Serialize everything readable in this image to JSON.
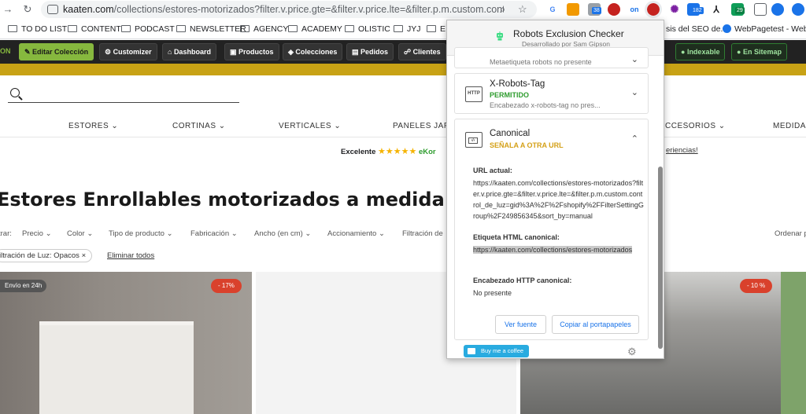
{
  "browser": {
    "url_host": "kaaten.com",
    "url_path": "/collections/estores-motorizados?filter.v.price.gte=&filter.v.price.lte=&filter.p.m.custom.control_de_luz=gid...",
    "ext_badges": [
      "38",
      "182",
      "29"
    ],
    "ext_letters": [
      "G",
      "on"
    ]
  },
  "bookmarks": [
    {
      "label": "TO DO LIST"
    },
    {
      "label": "CONTENT"
    },
    {
      "label": "PODCAST"
    },
    {
      "label": "NEWSLETTER"
    },
    {
      "label": "AGENCY"
    },
    {
      "label": "ACADEMY"
    },
    {
      "label": "OLISTIC"
    },
    {
      "label": "JYJ"
    },
    {
      "label": "EG"
    },
    {
      "label": "sis del SEO de..."
    },
    {
      "label": "WebPagetest - Web..."
    }
  ],
  "adminbar": {
    "left_cut": "ON",
    "edit": "Editar Colección",
    "items": [
      "Customizer",
      "Dashboard",
      "Productos",
      "Colecciones",
      "Pedidos",
      "Clientes"
    ],
    "indexable": "Indexable",
    "sitemap": "En Sitemap"
  },
  "store": {
    "menu": [
      "ESTORES",
      "CORTINAS",
      "VERTICALES",
      "PANELES JAPO",
      "CCESORIOS",
      "MEDIDAS"
    ],
    "review_label": "Excelente",
    "review_brand": "eKor",
    "review_link": "eriencias!",
    "title": "Estores Enrollables motorizados a medida",
    "filter_prefix": "trar:",
    "filters": [
      "Precio",
      "Color",
      "Tipo de producto",
      "Fabricación",
      "Ancho (en cm)",
      "Accionamiento",
      "Filtración de"
    ],
    "sort": "Ordenar p",
    "chip": "iltración de Luz: Opacos",
    "clear": "Eliminar todos",
    "ship_tag": "Envío en 24h",
    "sale1": "- 17%",
    "sale2": "- 10 %"
  },
  "popup": {
    "title": "Robots Exclusion Checker",
    "subtitle": "Desarrollado por Sam Gipson",
    "meta_desc": "Metaetiqueta robots no presente",
    "xrobots": {
      "title": "X-Robots-Tag",
      "status": "PERMITIDO",
      "desc": "Encabezado x-robots-tag no pres...",
      "icon": "HTTP"
    },
    "canonical": {
      "title": "Canonical",
      "status": "SEÑALA A OTRA URL",
      "url_label": "URL actual:",
      "url_value": "https://kaaten.com/collections/estores-motorizados?filter.v.price.gte=&filter.v.price.lte=&filter.p.m.custom.control_de_luz=gid%3A%2F%2Fshopify%2FFilterSettingGroup%2F249856345&sort_by=manual",
      "html_label": "Etiqueta HTML canonical:",
      "html_value": "https://kaaten.com/collections/estores-motorizados",
      "http_label": "Encabezado HTTP canonical:",
      "http_value": "No presente"
    },
    "btn_source": "Ver fuente",
    "btn_copy": "Copiar al portapapeles",
    "coffee": "Buy me a coffee"
  },
  "colors": {
    "status_ok": "#2e9c2e",
    "status_warn": "#d4a017",
    "admin_green": "#86b83e",
    "gold": "#c8a215",
    "sale": "#d9412c"
  }
}
